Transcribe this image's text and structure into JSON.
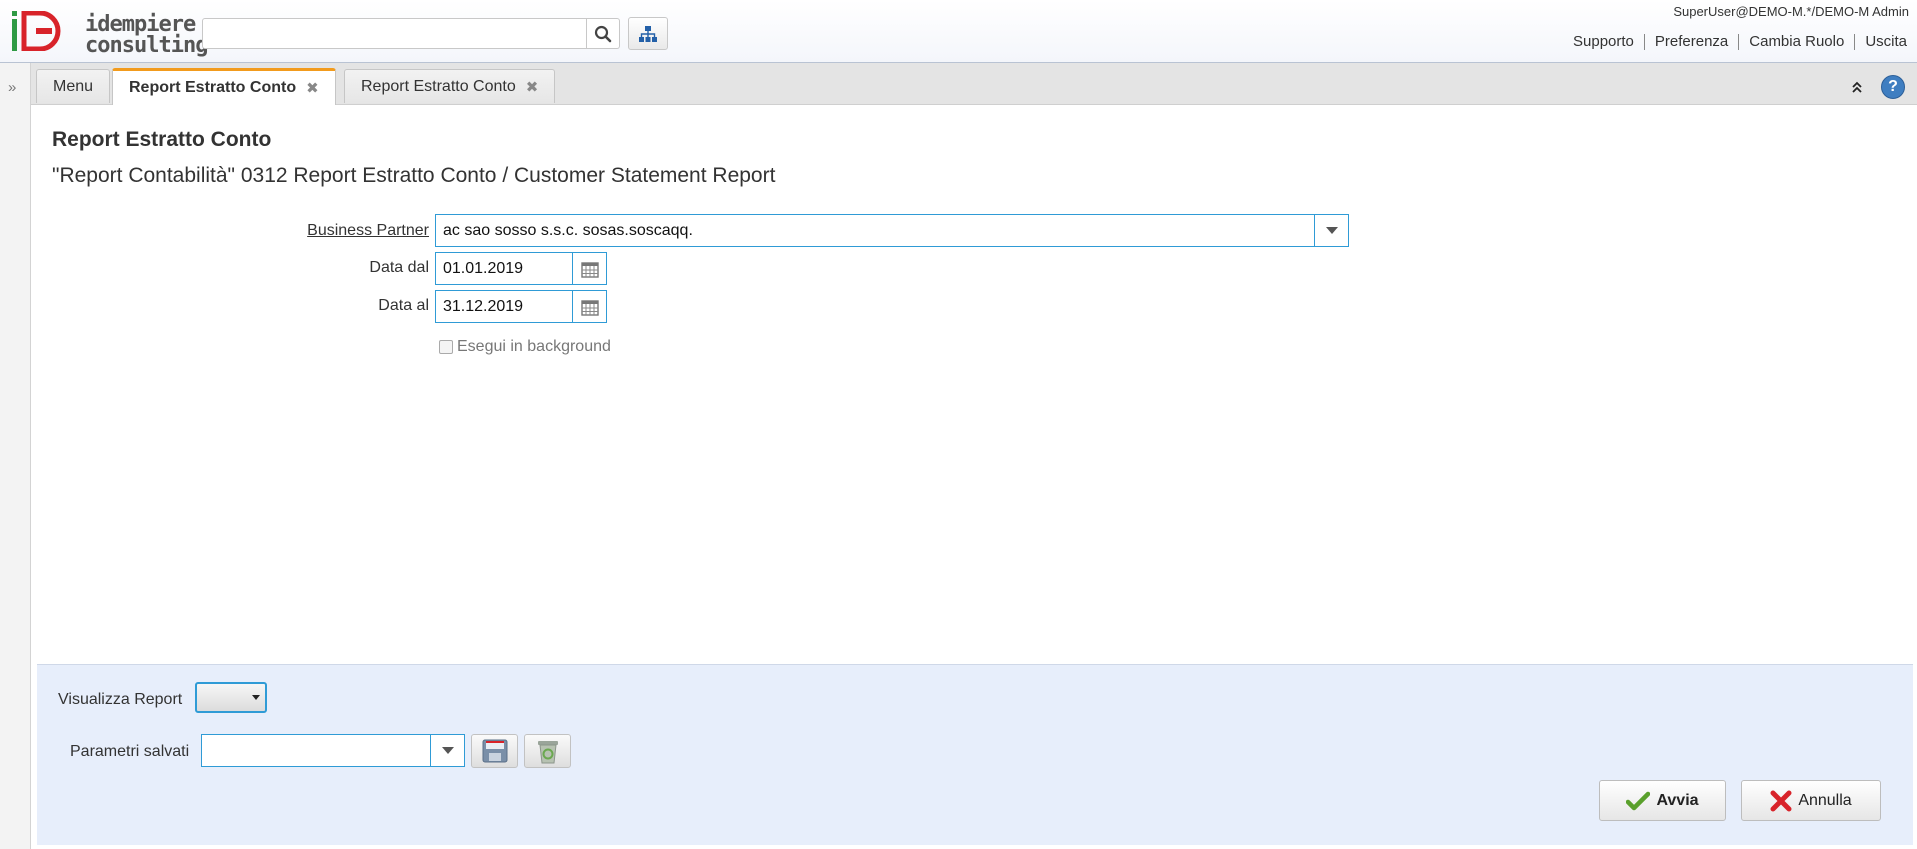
{
  "header": {
    "logo_line1": "idempiere",
    "logo_line2": "consulting",
    "search_placeholder": "",
    "user": "SuperUser@DEMO-M.*/DEMO-M Admin",
    "links": [
      "Supporto",
      "Preferenza",
      "Cambia Ruolo",
      "Uscita"
    ]
  },
  "tabs": [
    {
      "label": "Menu",
      "closable": false
    },
    {
      "label": "Report Estratto Conto",
      "closable": true,
      "active": true
    },
    {
      "label": "Report Estratto Conto",
      "closable": true
    }
  ],
  "content": {
    "title": "Report Estratto Conto",
    "subtitle": "\"Report Contabilità\" 0312 Report Estratto Conto / Customer Statement Report",
    "fields": {
      "business_partner_label": "Business Partner",
      "business_partner_value": "ac sao sosso s.s.c. sosas.soscaqq.",
      "date_from_label": "Data dal",
      "date_from_value": "01.01.2019",
      "date_to_label": "Data al",
      "date_to_value": "31.12.2019",
      "background_label": "Esegui in background"
    }
  },
  "footer": {
    "report_view_label": "Visualizza Report",
    "saved_params_label": "Parametri salvati",
    "saved_params_value": "",
    "run_label": "Avvia",
    "cancel_label": "Annulla"
  },
  "colors": {
    "accent_tab": "#f29b1d",
    "field_border": "#2f9bd6",
    "footer_bg": "#e7eefb",
    "brand_red": "#d8232a",
    "brand_green": "#2e9a44"
  }
}
